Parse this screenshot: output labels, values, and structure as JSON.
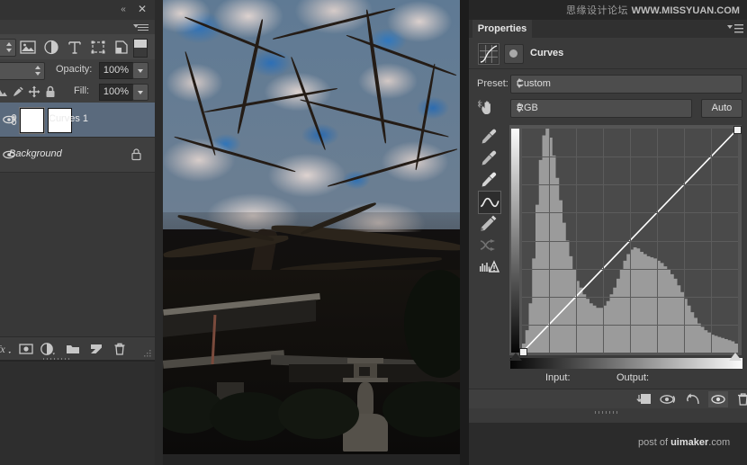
{
  "app": {
    "name": "Adobe Photoshop",
    "accent_selected_layer": "#5a6a7d",
    "panel_bg": "#3a3a3a",
    "field_bg": "#4d4d4d"
  },
  "watermark": {
    "chinese": "思缘设计论坛",
    "english": "WWW.MISSYUAN.COM"
  },
  "credit": {
    "prefix": "post of ",
    "brand": "uimaker",
    "suffix": ".com"
  },
  "layers_panel": {
    "collapse_icon": "double-chevron-left-icon",
    "close_icon": "close-icon",
    "menu_icon": "panel-menu-icon",
    "filter_icons": [
      {
        "name": "filter-image-icon",
        "label": "Image"
      },
      {
        "name": "filter-adjustment-icon",
        "label": "Adjustment"
      },
      {
        "name": "filter-type-icon",
        "label": "Type"
      },
      {
        "name": "filter-shape-icon",
        "label": "Shape"
      },
      {
        "name": "filter-smartobject-icon",
        "label": "Smart Object"
      }
    ],
    "filter_toggle": "filter-enable-toggle",
    "kind_select": {
      "value": "",
      "stepper": "updown-stepper-icon"
    },
    "blend_mode": {
      "value": ""
    },
    "opacity": {
      "label": "Opacity:",
      "value": "100%",
      "dropdown": "chevron-down-icon"
    },
    "fill": {
      "label": "Fill:",
      "value": "100%",
      "dropdown": "chevron-down-icon"
    },
    "lock_icons": [
      {
        "name": "lock-transparent-pixels-icon"
      },
      {
        "name": "lock-image-pixels-icon"
      },
      {
        "name": "lock-position-icon"
      },
      {
        "name": "lock-all-icon"
      }
    ],
    "layers": [
      {
        "name": "Curves 1",
        "selected": true,
        "has_mask": true,
        "link_icon": "link-icon",
        "eye_icon": "eye-icon",
        "locked": false
      },
      {
        "name": "Background",
        "selected": false,
        "has_mask": false,
        "eye_icon": "eye-icon",
        "locked": true,
        "lock_icon": "lock-icon"
      }
    ],
    "bottom_buttons": [
      {
        "name": "link-layers-button",
        "icon": "fx-icon",
        "label": "fx"
      },
      {
        "name": "add-layer-mask-button",
        "icon": "layer-mask-icon"
      },
      {
        "name": "new-adjustment-layer-button",
        "icon": "half-circle-icon"
      },
      {
        "name": "new-group-button",
        "icon": "folder-icon"
      },
      {
        "name": "new-layer-button",
        "icon": "new-layer-icon"
      },
      {
        "name": "delete-layer-button",
        "icon": "trash-icon"
      }
    ]
  },
  "document": {
    "subject": "cherry blossom tree over temple roof with stone lantern",
    "zoom_fit": true
  },
  "properties_panel": {
    "tab_label": "Properties",
    "menu_icon": "panel-menu-icon",
    "adjustment": {
      "title": "Curves",
      "badge_icon": "curves-icon",
      "mask_icon": "layer-mask-thumb-icon"
    },
    "preset": {
      "label": "Preset:",
      "value": "Custom",
      "stepper_icon": "updown-stepper-icon"
    },
    "channel": {
      "hand_icon": "target-adjustment-hand-icon",
      "value": "RGB",
      "stepper_icon": "updown-stepper-icon",
      "auto_label": "Auto"
    },
    "curve_tools": [
      {
        "name": "set-black-point-eyedropper",
        "icon": "eyedropper-black-icon",
        "selected": false
      },
      {
        "name": "set-gray-point-eyedropper",
        "icon": "eyedropper-gray-icon",
        "selected": false
      },
      {
        "name": "set-white-point-eyedropper",
        "icon": "eyedropper-white-icon",
        "selected": false
      },
      {
        "name": "edit-points-tool",
        "icon": "curve-points-icon",
        "selected": true
      },
      {
        "name": "draw-curve-pencil-tool",
        "icon": "pencil-icon",
        "selected": false
      },
      {
        "name": "smooth-curve-button",
        "icon": "smooth-curve-icon",
        "selected": false
      },
      {
        "name": "clipping-warning-toggle",
        "icon": "clipping-warning-icon",
        "selected": false
      }
    ],
    "input_label": "Input:",
    "output_label": "Output:",
    "input_value": "",
    "output_value": "",
    "footer_buttons": [
      {
        "name": "clip-to-layer-button",
        "icon": "clip-to-layer-icon"
      },
      {
        "name": "toggle-before-after-button",
        "icon": "eye-preview-icon"
      },
      {
        "name": "reset-adjustment-button",
        "icon": "reset-arrow-icon"
      },
      {
        "name": "toggle-visibility-button",
        "icon": "eye-icon",
        "active": true
      },
      {
        "name": "delete-adjustment-button",
        "icon": "trash-icon"
      }
    ]
  },
  "chart_data": {
    "type": "line",
    "title": "Curves (RGB)",
    "xlabel": "Input",
    "ylabel": "Output",
    "xlim": [
      0,
      255
    ],
    "ylim": [
      0,
      255
    ],
    "grid": true,
    "grid_divisions": 8,
    "curve_points": [
      {
        "input": 0,
        "output": 0
      },
      {
        "input": 255,
        "output": 255
      }
    ],
    "curve_is_linear": true,
    "histogram": {
      "channel": "RGB",
      "bins": 64,
      "values": [
        0.04,
        0.1,
        0.22,
        0.42,
        0.66,
        0.86,
        0.97,
        1.0,
        0.96,
        0.88,
        0.78,
        0.68,
        0.58,
        0.5,
        0.43,
        0.37,
        0.32,
        0.29,
        0.26,
        0.24,
        0.22,
        0.21,
        0.2,
        0.2,
        0.21,
        0.23,
        0.26,
        0.29,
        0.33,
        0.37,
        0.41,
        0.44,
        0.46,
        0.47,
        0.465,
        0.45,
        0.44,
        0.43,
        0.425,
        0.42,
        0.41,
        0.4,
        0.385,
        0.37,
        0.35,
        0.33,
        0.3,
        0.27,
        0.24,
        0.21,
        0.18,
        0.155,
        0.13,
        0.115,
        0.1,
        0.09,
        0.08,
        0.075,
        0.07,
        0.065,
        0.06,
        0.055,
        0.05,
        0.04
      ]
    }
  }
}
